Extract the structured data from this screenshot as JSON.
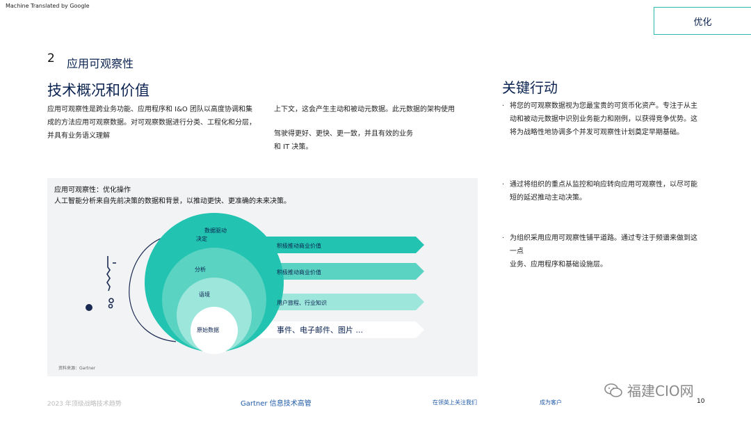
{
  "header": {
    "machine_translated": "Machine Translated by Google",
    "tab_label": "优化"
  },
  "section": {
    "number": "2",
    "title": "应用可观察性"
  },
  "main": {
    "title": "技术概况和价值",
    "para1": "应用可观察性是跨业务功能、应用程序和 I&O 团队以高度协调和集成的方法应用可观察数据。对可观察数据进行分类、工程化和分层，并具有业务语义理解",
    "para2": "上下文，这会产生主动和被动元数据。此元数据的架构使用",
    "para3": "驾驶得更好、更快、更一致，并且有效的业务和 IT 决策。"
  },
  "key_actions": {
    "title": "关键行动",
    "items": [
      "将您的可观察数据视为您最宝贵的可货币化资产。专注于从主动和被动元数据中识别业务能力和刚例，以获得竞争优势。这将为战略性地协调多个并发可观察性计划奠定早期基础。",
      "通过将组织的重点从监控和响应转向应用可观察性，以尽可能短的延迟推动主动决策。",
      "为组织采用应用可观察性铺平道路。通过专注于频谱来做到这一点\n业务、应用程序和基础设施层。"
    ],
    "bullet_char": "·"
  },
  "figure": {
    "title": "应用可观察性：优化操作",
    "subtitle": "人工智能分析来自先前决策的数据和背景，以推动更快、更准确的未来决策。",
    "source": "资料来源：Gartner",
    "layers": [
      {
        "label_line1": "数据驱动",
        "label_line2": "决定",
        "arrow_text": "积极推动商业价值",
        "color": "#22c3b0"
      },
      {
        "label_line1": "分析",
        "label_line2": "",
        "arrow_text": "积极推动商业价值",
        "color": "#5ad3c3"
      },
      {
        "label_line1": "语境",
        "label_line2": "",
        "arrow_text": "用户旅程、行业知识",
        "color": "#9de6dc"
      },
      {
        "label_line1": "原始数据",
        "label_line2": "",
        "arrow_text": "事件、电子邮件、图片 ...",
        "color": "#ffffff"
      }
    ]
  },
  "footer": {
    "left": "2023 年顶级战略技术趋势",
    "center": "Gartner 信息技术高管",
    "follow": "在领英上关注我们",
    "client": "成为客户",
    "page_number": "10"
  },
  "watermark": {
    "text": "福建CIO网",
    "icon": "wechat-icon"
  }
}
